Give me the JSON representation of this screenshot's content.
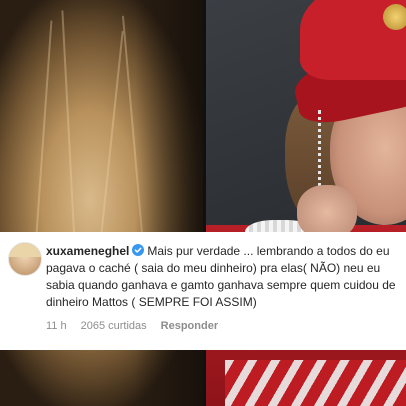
{
  "comment": {
    "username": "xuxameneghel",
    "text": "Mais pur verdade ... lembrando a todos do eu pagava o caché ( saia do meu dinheiro) pra elas( NÃO) neu eu sabia quando ganhava e gamto ganhava sempre quem cuidou de dinheiro Mattos ( SEMPRE FOI ASSIM)",
    "time": "11 h",
    "likes": "2065 curtidas",
    "reply_label": "Responder"
  },
  "colors": {
    "verified_badge": "#3897f0",
    "text": "#262626",
    "meta": "#8e8e8e",
    "card_background": "#ffffff"
  },
  "icons": {
    "verified": "verified-badge-icon"
  }
}
